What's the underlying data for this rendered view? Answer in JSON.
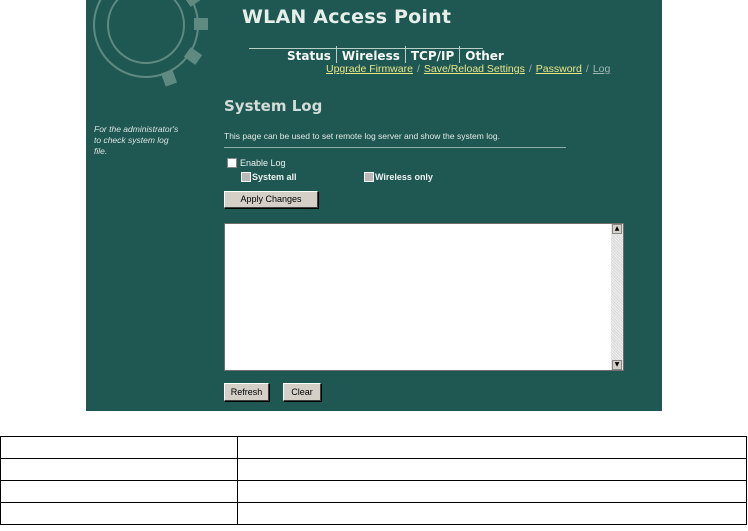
{
  "header": {
    "title": "WLAN Access Point"
  },
  "tabs": [
    "Status",
    "Wireless",
    "TCP/IP",
    "Other"
  ],
  "sublinks": [
    "Upgrade Firmware",
    "Save/Reload Settings",
    "Password",
    "Log"
  ],
  "sidebar": {
    "note": "For the administrator's to check system log file."
  },
  "main": {
    "title": "System Log",
    "description": "This page can be used to set remote log server and show the system log.",
    "enable_log_label": "Enable Log",
    "system_all_label": "System all",
    "wireless_only_label": "Wireless only",
    "apply_label": "Apply Changes",
    "log_text": "",
    "refresh_label": "Refresh",
    "clear_label": "Clear"
  },
  "colors": {
    "background": "#1f5753",
    "link": "#e8e88a"
  }
}
